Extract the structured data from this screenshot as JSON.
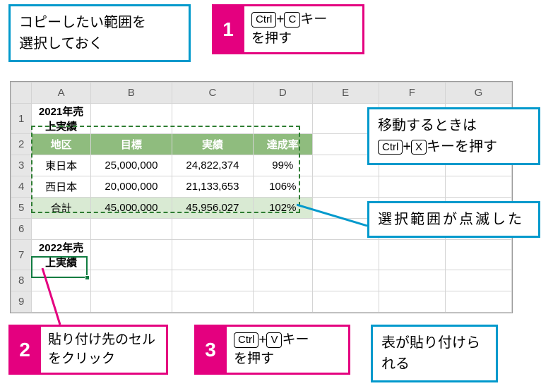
{
  "callouts": {
    "precopy": "コピーしたい範囲を\n選択しておく",
    "move": {
      "prefix": "移動するときは",
      "key1": "Ctrl",
      "plus": "+",
      "key2": "X",
      "suffix": "キーを押す"
    },
    "blink": "選択範囲が点滅した",
    "paste_result": "表が貼り付けられる"
  },
  "steps": [
    {
      "num": "1",
      "key1": "Ctrl",
      "plus": "+",
      "key2": "C",
      "suffix": "キー",
      "line2": "を押す"
    },
    {
      "num": "2",
      "text": "貼り付け先のセルをクリック"
    },
    {
      "num": "3",
      "key1": "Ctrl",
      "plus": "+",
      "key2": "V",
      "suffix": "キー",
      "line2": "を押す"
    }
  ],
  "sheet": {
    "cols": [
      "A",
      "B",
      "C",
      "D",
      "E",
      "F",
      "G"
    ],
    "rows": [
      "1",
      "2",
      "3",
      "4",
      "5",
      "6",
      "7",
      "8",
      "9"
    ],
    "title1": "2021年売上実績",
    "headers": [
      "地区",
      "目標",
      "実績",
      "達成率"
    ],
    "data": [
      {
        "region": "東日本",
        "target": "25,000,000",
        "actual": "24,822,374",
        "rate": "99%"
      },
      {
        "region": "西日本",
        "target": "20,000,000",
        "actual": "21,133,653",
        "rate": "106%"
      },
      {
        "region": "合計",
        "target": "45,000,000",
        "actual": "45,956,027",
        "rate": "102%"
      }
    ],
    "title2": "2022年売上実績"
  },
  "chart_data": {
    "type": "table",
    "title": "2021年売上実績",
    "columns": [
      "地区",
      "目標",
      "実績",
      "達成率"
    ],
    "rows": [
      [
        "東日本",
        25000000,
        24822374,
        "99%"
      ],
      [
        "西日本",
        20000000,
        21133653,
        "106%"
      ],
      [
        "合計",
        45000000,
        45956027,
        "102%"
      ]
    ]
  }
}
